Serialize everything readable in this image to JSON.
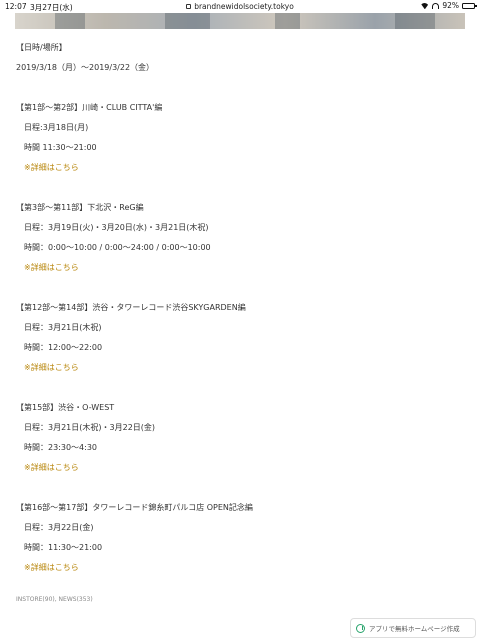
{
  "status_bar": {
    "time": "12:07",
    "date": "3月27日(水)",
    "url": "brandnewidolsociety.tokyo",
    "battery_percent": "92%",
    "battery_level": 0.92
  },
  "schedule": {
    "date_heading": "【日時/場所】",
    "date_range": "2019/3/18（月）〜2019/3/22（金）",
    "sections": [
      {
        "title": "【第1部〜第2部】川崎・CLUB CITTA'編",
        "date_line": "日程:3月18日(月)",
        "time_line": "時間 11:30〜21:00",
        "link": "※詳細はこちら"
      },
      {
        "title": "【第3部〜第11部】下北沢・ReG編",
        "date_line": "日程：3月19日(火)・3月20日(水)・3月21日(木祝)",
        "time_line": "時間：0:00〜10:00 / 0:00〜24:00 / 0:00〜10:00",
        "link": "※詳細はこちら"
      },
      {
        "title": "【第12部〜第14部】渋谷・タワーレコード渋谷SKYGARDEN編",
        "date_line": "日程：3月21日(木祝)",
        "time_line": "時間：12:00〜22:00",
        "link": "※詳細はこちら"
      },
      {
        "title": "【第15部】渋谷・O-WEST",
        "date_line": "日程：3月21日(木祝)・3月22日(金)",
        "time_line": "時間：23:30〜4:30",
        "link": "※詳細はこちら"
      },
      {
        "title": "【第16部〜第17部】タワーレコード錦糸町パルコ店 OPEN記念編",
        "date_line": "日程：3月22日(金)",
        "time_line": "時間：11:30〜21:00",
        "link": "※詳細はこちら"
      }
    ]
  },
  "footer": {
    "tags": "INSTORE(90), NEWS(353)"
  },
  "badge": {
    "label": "アプリで無料ホームページ作成",
    "icon": "app-logo-icon",
    "accent": "#27a36b"
  },
  "colors": {
    "text": "#333333",
    "link": "#b8860b"
  }
}
